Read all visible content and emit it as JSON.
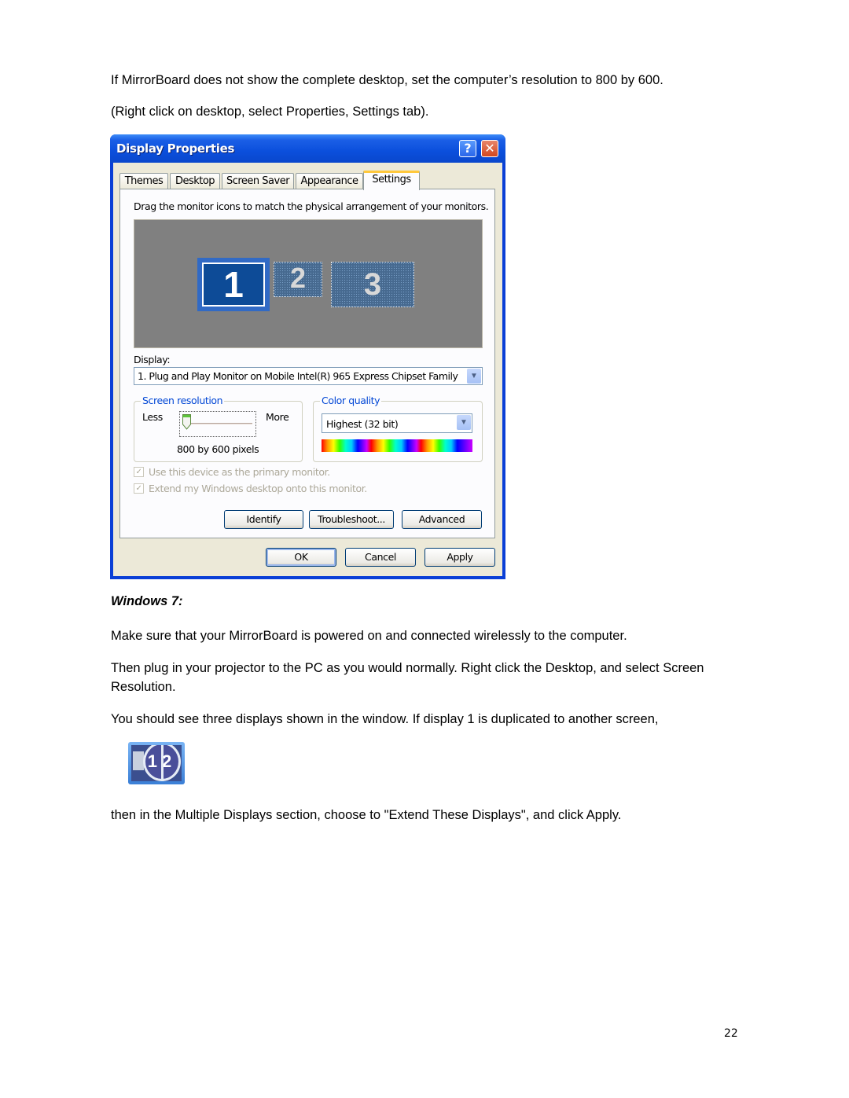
{
  "document": {
    "intro_paragraph": "If MirrorBoard does not show the complete desktop, set the computer’s resolution to 800 by 600.",
    "instruction_paragraph": "(Right click on desktop, select Properties, Settings tab).",
    "windows7_heading": "Windows 7:",
    "w7_paragraph_1": "Make sure that your MirrorBoard is powered on and connected wirelessly to the computer.",
    "w7_paragraph_2": "Then plug in your projector to the PC as you would normally. Right click the Desktop, and select Screen Resolution.",
    "w7_paragraph_3": "You should see three displays shown in the window. If display 1 is duplicated to another screen,",
    "w7_paragraph_4": "then in the Multiple Displays section, choose to \"Extend These Displays\", and click Apply.",
    "page_number": "22"
  },
  "dialog": {
    "title": "Display Properties",
    "help_button": "?",
    "close_button": "✕",
    "tabs": [
      {
        "label": "Themes",
        "active": false
      },
      {
        "label": "Desktop",
        "active": false
      },
      {
        "label": "Screen Saver",
        "active": false
      },
      {
        "label": "Appearance",
        "active": false
      },
      {
        "label": "Settings",
        "active": true
      }
    ],
    "instruction": "Drag the monitor icons to match the physical arrangement of your monitors.",
    "monitors": [
      {
        "number": "1",
        "selected": true
      },
      {
        "number": "2",
        "selected": false
      },
      {
        "number": "3",
        "selected": false
      }
    ],
    "display_label": "Display:",
    "display_value": "1. Plug and Play Monitor on Mobile Intel(R) 965 Express Chipset Family",
    "screen_resolution": {
      "title": "Screen resolution",
      "less_label": "Less",
      "more_label": "More",
      "value_text": "800 by 600 pixels",
      "slider_position": 0
    },
    "color_quality": {
      "title": "Color quality",
      "value": "Highest (32 bit)"
    },
    "checkboxes": [
      {
        "label": "Use this device as the primary monitor.",
        "checked": true,
        "enabled": false
      },
      {
        "label": "Extend my Windows desktop onto this monitor.",
        "checked": true,
        "enabled": false
      }
    ],
    "buttons": {
      "identify": "Identify",
      "troubleshoot": "Troubleshoot...",
      "advanced": "Advanced",
      "ok": "OK",
      "cancel": "Cancel",
      "apply": "Apply"
    }
  },
  "w7_icon": {
    "left_digit": "1",
    "right_digit": "2"
  }
}
